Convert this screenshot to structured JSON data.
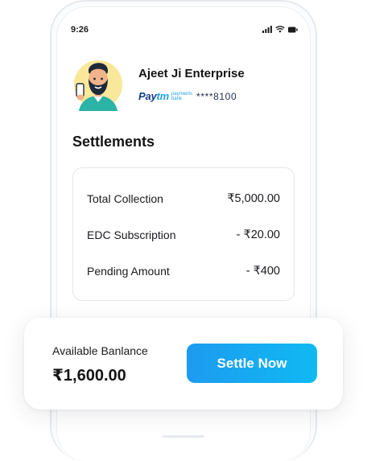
{
  "status_bar": {
    "time": "9:26"
  },
  "merchant": {
    "name": "Ajeet Ji Enterprise",
    "bank_brand_main": "Pay",
    "bank_brand_accent": "tm",
    "bank_brand_sub_1": "payments",
    "bank_brand_sub_2": "bank",
    "account_masked": "****8100"
  },
  "settlements": {
    "title": "Settlements",
    "rows": [
      {
        "label": "Total Collection",
        "amount": "₹5,000.00"
      },
      {
        "label": "EDC Subscription",
        "amount": "- ₹20.00"
      },
      {
        "label": "Pending Amount",
        "amount": "- ₹400"
      }
    ]
  },
  "balance": {
    "label": "Available Banlance",
    "amount": "₹1,600.00",
    "settle_label": "Settle Now"
  },
  "colors": {
    "accent": "#1d9bf0",
    "brand_dark": "#0f3e8c",
    "brand_light": "#1fa4e3",
    "avatar_bg": "#f9e79a",
    "avatar_shirt": "#2bb3a6"
  },
  "icons": [
    "signal-icon",
    "wifi-icon",
    "battery-icon"
  ]
}
